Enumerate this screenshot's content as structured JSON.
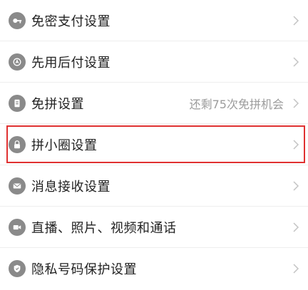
{
  "colors": {
    "icon_bg": "#8a8a8a",
    "text": "#222222",
    "muted": "#9b9b9b",
    "highlight": "#e03131"
  },
  "settings": {
    "items": [
      {
        "label": "免密支付设置",
        "icon": "key-icon"
      },
      {
        "label": "先用后付设置",
        "icon": "badge-icon"
      },
      {
        "label": "免拼设置",
        "icon": "ticket-icon",
        "value": "还剩75次免拼机会"
      },
      {
        "label": "拼小圈设置",
        "icon": "lock-icon",
        "highlighted": true
      },
      {
        "label": "消息接收设置",
        "icon": "mail-icon"
      },
      {
        "label": "直播、照片、视频和通话",
        "icon": "video-camera-icon"
      },
      {
        "label": "隐私号码保护设置",
        "icon": "shield-icon"
      }
    ]
  }
}
